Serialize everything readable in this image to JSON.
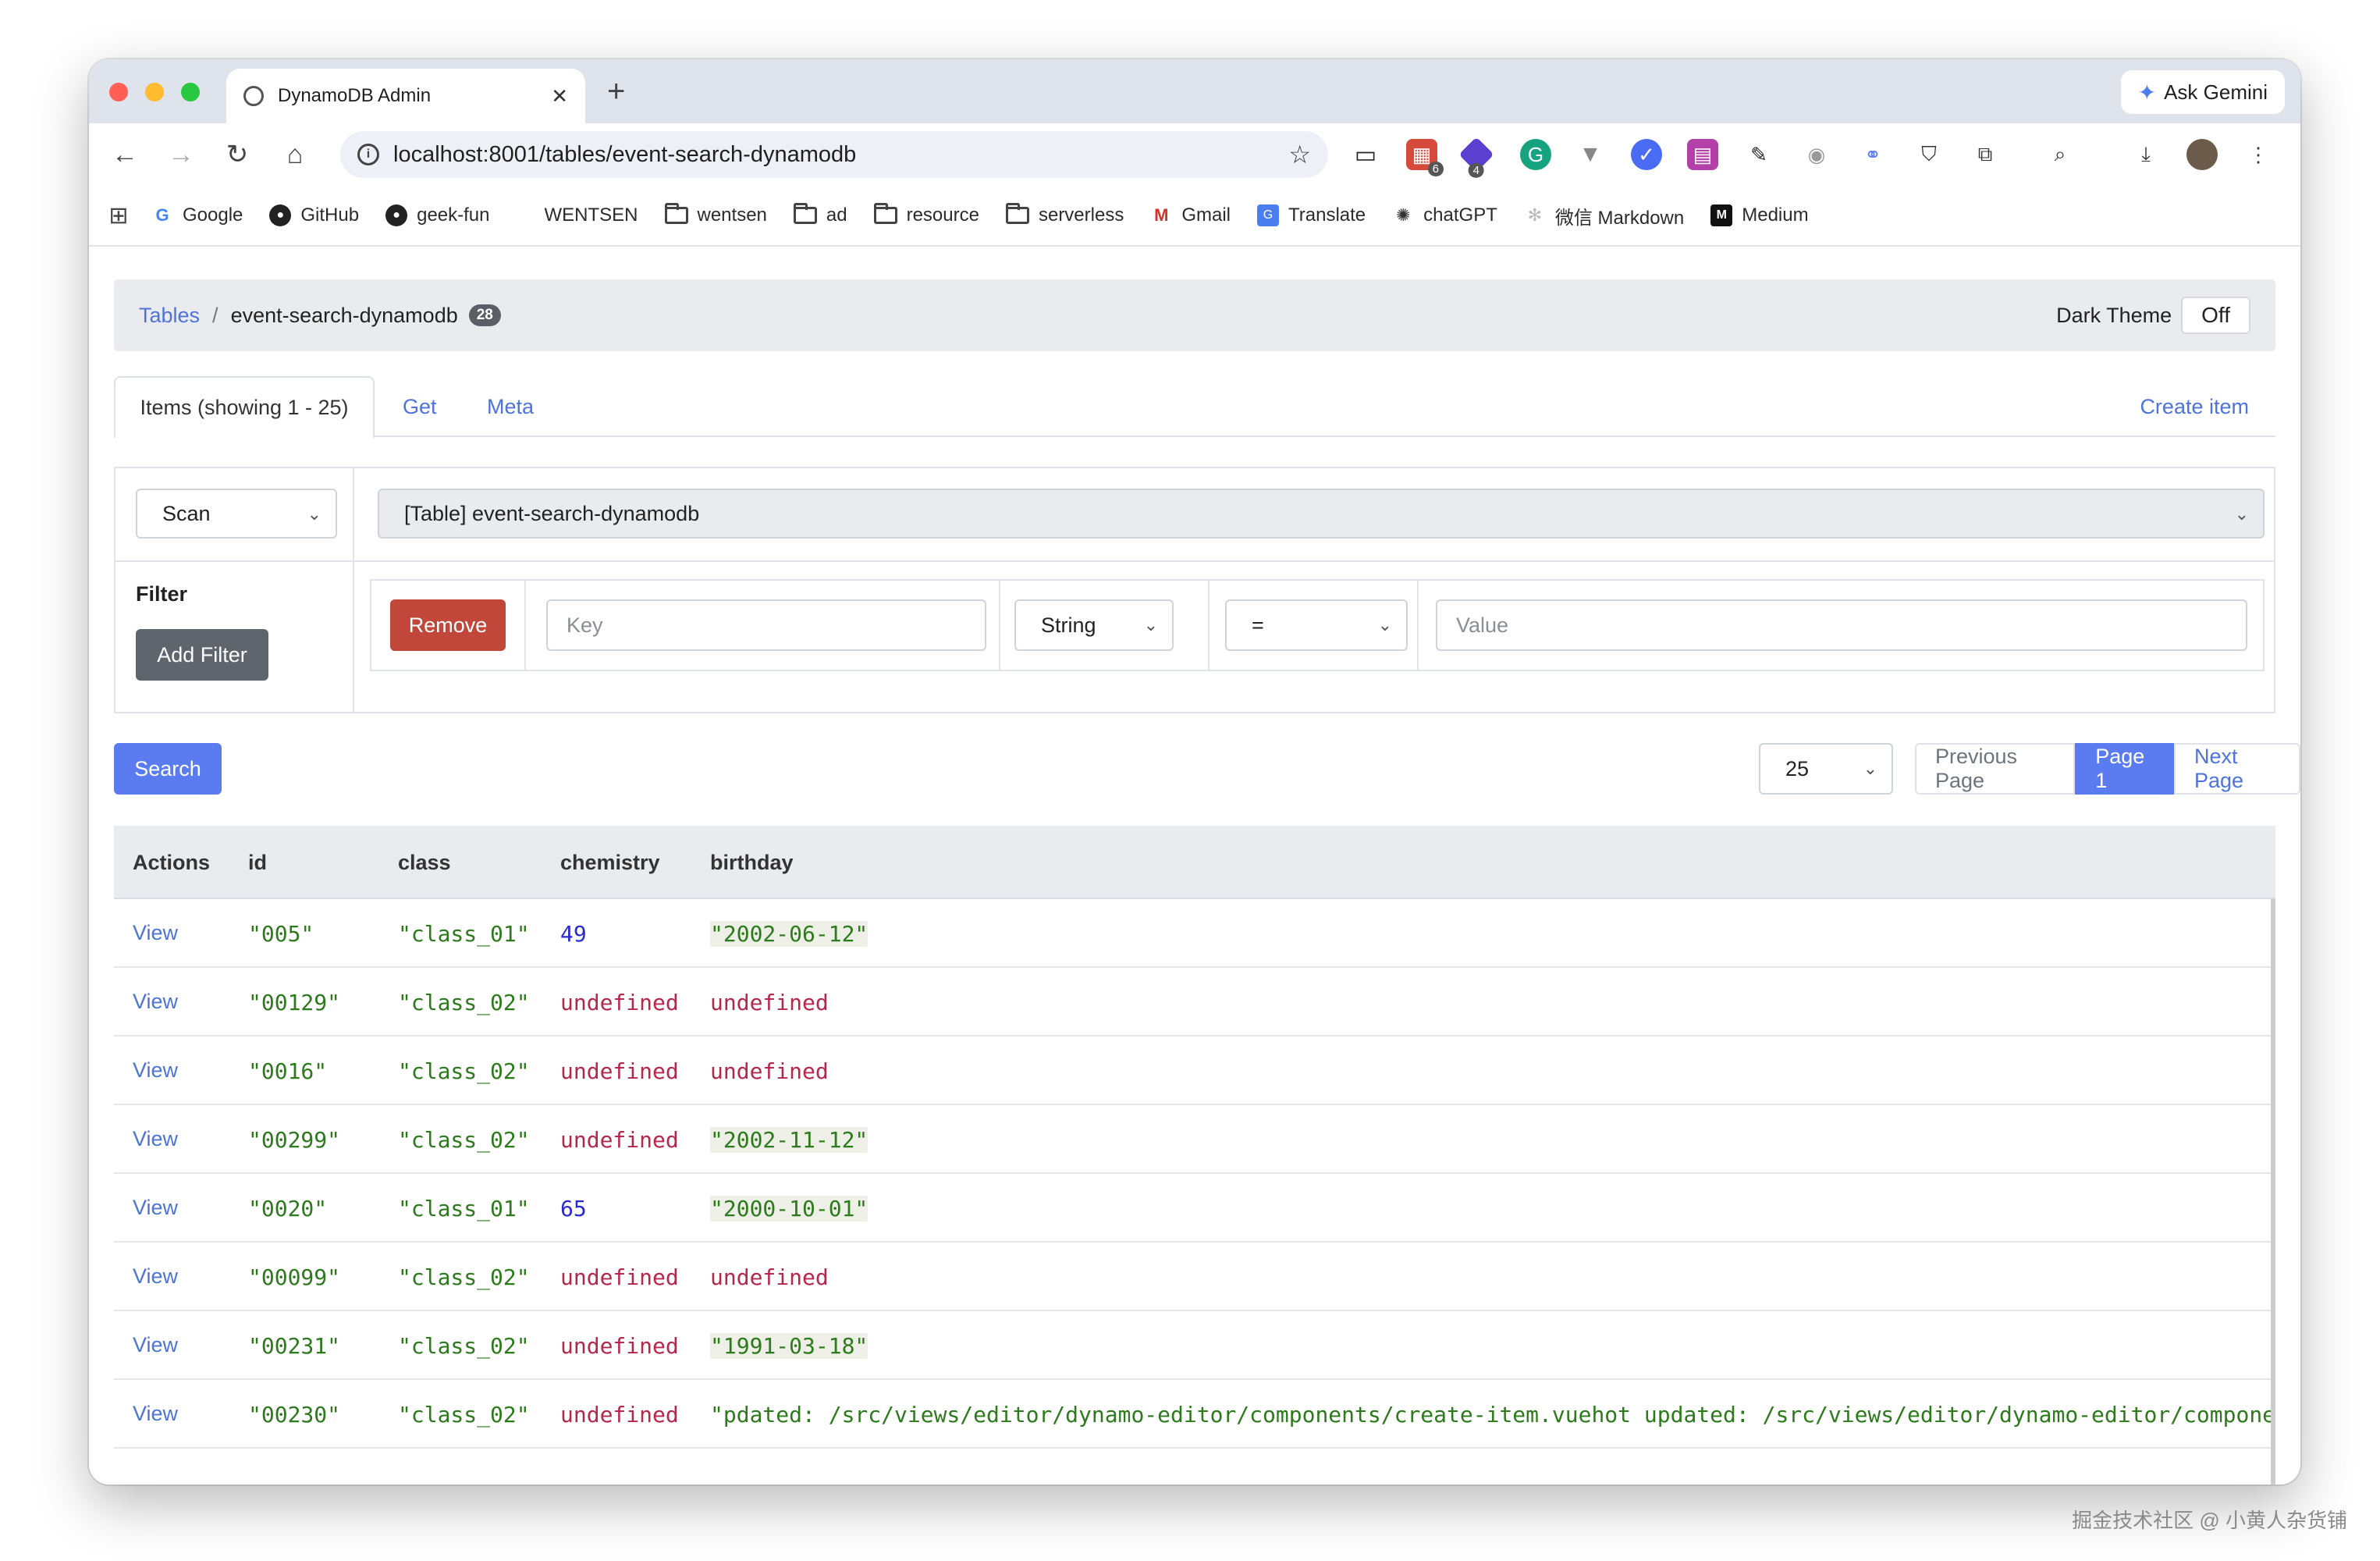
{
  "browser": {
    "tab_title": "DynamoDB Admin",
    "tab_close": "✕",
    "new_tab": "+",
    "ask_gemini": "Ask Gemini",
    "url": "localhost:8001/tables/event-search-dynamodb",
    "extension_badges": [
      "6",
      "4"
    ],
    "traffic_colors": [
      "#ff5f57",
      "#febc2e",
      "#28c840"
    ],
    "bookmarks": [
      {
        "label": "Google",
        "icon": "google-icon"
      },
      {
        "label": "GitHub",
        "icon": "github-icon"
      },
      {
        "label": "geek-fun",
        "icon": "github-icon"
      },
      {
        "label": "WENTSEN",
        "icon": "none"
      },
      {
        "label": "wentsen",
        "icon": "folder-icon"
      },
      {
        "label": "ad",
        "icon": "folder-icon"
      },
      {
        "label": "resource",
        "icon": "folder-icon"
      },
      {
        "label": "serverless",
        "icon": "folder-icon"
      },
      {
        "label": "Gmail",
        "icon": "gmail-icon"
      },
      {
        "label": "Translate",
        "icon": "translate-icon"
      },
      {
        "label": "chatGPT",
        "icon": "chatgpt-icon"
      },
      {
        "label": "微信 Markdown",
        "icon": "wechat-markdown-icon"
      },
      {
        "label": "Medium",
        "icon": "medium-icon"
      }
    ]
  },
  "page": {
    "breadcrumb": {
      "root": "Tables",
      "separator": "/",
      "current": "event-search-dynamodb",
      "badge": "28"
    },
    "dark_theme": {
      "label": "Dark Theme",
      "value": "Off"
    },
    "tabs": {
      "items": "Items (showing 1 - 25)",
      "get": "Get",
      "meta": "Meta",
      "create": "Create item"
    },
    "query": {
      "mode": "Scan",
      "index": "[Table] event-search-dynamodb"
    },
    "filter": {
      "label": "Filter",
      "add_button": "Add Filter",
      "remove_button": "Remove",
      "key_placeholder": "Key",
      "type": "String",
      "operator": "=",
      "value_placeholder": "Value"
    },
    "search_button": "Search",
    "pagination": {
      "page_size": "25",
      "previous": "Previous Page",
      "current": "Page 1",
      "next": "Next Page"
    },
    "colors": {
      "accent": "#5b7cf0",
      "danger": "#c0473a",
      "secondary": "#5f656c",
      "link": "#4e73d9"
    }
  },
  "table": {
    "columns": [
      "Actions",
      "id",
      "class",
      "chemistry",
      "birthday"
    ],
    "rows": [
      {
        "action": "View",
        "id": "\"005\"",
        "class": "\"class_01\"",
        "chemistry": "49",
        "birthday": "\"2002-06-12\""
      },
      {
        "action": "View",
        "id": "\"00129\"",
        "class": "\"class_02\"",
        "chemistry": "undefined",
        "birthday": "undefined"
      },
      {
        "action": "View",
        "id": "\"0016\"",
        "class": "\"class_02\"",
        "chemistry": "undefined",
        "birthday": "undefined"
      },
      {
        "action": "View",
        "id": "\"00299\"",
        "class": "\"class_02\"",
        "chemistry": "undefined",
        "birthday": "\"2002-11-12\""
      },
      {
        "action": "View",
        "id": "\"0020\"",
        "class": "\"class_01\"",
        "chemistry": "65",
        "birthday": "\"2000-10-01\""
      },
      {
        "action": "View",
        "id": "\"00099\"",
        "class": "\"class_02\"",
        "chemistry": "undefined",
        "birthday": "undefined"
      },
      {
        "action": "View",
        "id": "\"00231\"",
        "class": "\"class_02\"",
        "chemistry": "undefined",
        "birthday": "\"1991-03-18\""
      },
      {
        "action": "View",
        "id": "\"00230\"",
        "class": "\"class_02\"",
        "chemistry": "undefined",
        "birthday": "\"pdated: /src/views/editor/dynamo-editor/components/create-item.vuehot updated: /src/views/editor/dynamo-editor/components/create-item.vue\""
      }
    ]
  },
  "watermark": "掘金技术社区 @ 小黄人杂货铺"
}
